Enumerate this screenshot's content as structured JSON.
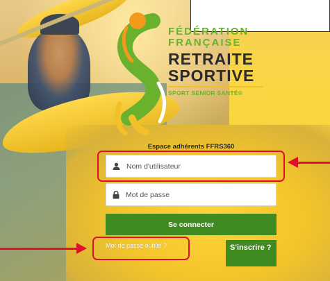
{
  "logo": {
    "line1": "FÉDÉRATION",
    "line2": "FRANÇAISE",
    "line3": "RETRAITE",
    "line4": "SPORTIVE",
    "line5": "SPORT SENIOR SANTÉ®"
  },
  "login": {
    "title": "Espace adhérents FFRS360",
    "username_placeholder": "Nom d'utilisateur",
    "password_placeholder": "Mot de passe",
    "submit_label": "Se connecter",
    "forgot_label": "Mot de passe oublié ?",
    "register_label": "S'inscrire ?"
  },
  "colors": {
    "brand_green": "#3f8a21",
    "logo_green": "#6ab22e",
    "highlight_red": "#e0102a"
  },
  "icons": {
    "username": "user-icon",
    "password": "lock-icon"
  }
}
